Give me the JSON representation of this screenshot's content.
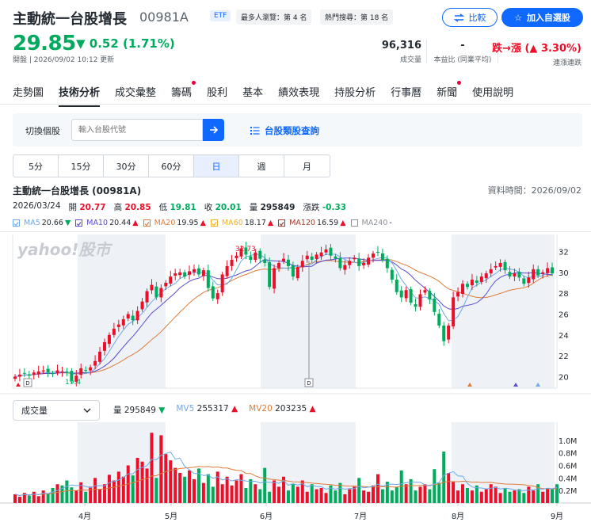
{
  "header": {
    "title": "主動統一台股增長",
    "ticker": "00981A",
    "etf_badge": "ETF",
    "rank1": "最多人瀏覽：第 4 名",
    "rank2": "熱門搜尋：第 18 名",
    "compare_label": "比較",
    "favorite_label": "加入自選股"
  },
  "quote": {
    "price": "29.85",
    "change": "0.52 (1.71%)",
    "update_time": "開盤 | 2026/09/02 10:12 更新",
    "volume": "96,316",
    "volume_label": "成交量",
    "pe": "-",
    "pe_label": "本益比 (同業平均)",
    "streak": "跌→漲 (▲ 3.30%)",
    "streak_label": "連漲連跌"
  },
  "tabs": [
    {
      "label": "走勢圖",
      "dot": false
    },
    {
      "label": "技術分析",
      "dot": false,
      "active": true
    },
    {
      "label": "成交彙整",
      "dot": false
    },
    {
      "label": "籌碼",
      "dot": true
    },
    {
      "label": "股利",
      "dot": false
    },
    {
      "label": "基本",
      "dot": false
    },
    {
      "label": "績效表現",
      "dot": false
    },
    {
      "label": "持股分析",
      "dot": false
    },
    {
      "label": "行事曆",
      "dot": false
    },
    {
      "label": "新聞",
      "dot": true
    },
    {
      "label": "使用說明",
      "dot": false
    }
  ],
  "search": {
    "label": "切換個股",
    "placeholder": "輸入台股代號",
    "category_link": "台股類股查詢"
  },
  "periods": [
    "5分",
    "15分",
    "30分",
    "60分",
    "日",
    "週",
    "月"
  ],
  "selected_period": "日",
  "info": {
    "name": "主動統一台股增長 (00981A)",
    "data_time": "資料時間：2026/09/02",
    "date": "2026/03/24",
    "open_label": "開",
    "open": "20.77",
    "high_label": "高",
    "high": "20.85",
    "low_label": "低",
    "low": "19.81",
    "close_label": "收",
    "close": "20.01",
    "vol_label": "量",
    "vol": "295849",
    "chg_label": "漲跌",
    "chg": "-0.33"
  },
  "ma": [
    {
      "name": "MA5",
      "value": "20.66",
      "arrow": "▼",
      "color": "#6ea8e8"
    },
    {
      "name": "MA10",
      "value": "20.44",
      "arrow": "▲",
      "color": "#5a4bd1"
    },
    {
      "name": "MA20",
      "value": "19.95",
      "arrow": "▲",
      "color": "#e07b39"
    },
    {
      "name": "MA60",
      "value": "18.17",
      "arrow": "▲",
      "color": "#f0b429"
    },
    {
      "name": "MA120",
      "value": "16.59",
      "arrow": "▲",
      "color": "#a23b2a"
    },
    {
      "name": "MA240",
      "value": "-",
      "arrow": "",
      "color": "#8a9099"
    }
  ],
  "volume_panel": {
    "select": "成交量",
    "vol_label": "量",
    "vol": "295849",
    "vol_arrow": "▼",
    "mv5_label": "MV5",
    "mv5": "255317",
    "mv5_arrow": "▲",
    "mv20_label": "MV20",
    "mv20": "203235",
    "mv20_arrow": "▲"
  },
  "chart_data": {
    "type": "candlestick",
    "price_axis_ticks": [
      "32",
      "30",
      "28",
      "26",
      "24",
      "22",
      "20"
    ],
    "ylim": [
      18.9,
      33.4
    ],
    "volume_axis_ticks": [
      "1.0M",
      "0.8M",
      "0.6M",
      "0.4M",
      "0.2M"
    ],
    "month_labels": [
      "4月",
      "5月",
      "6月",
      "7月",
      "8月",
      "9月"
    ],
    "annotations": {
      "high": "32.73",
      "low": "19.4"
    },
    "watermark": "yahoo!股市",
    "closes": [
      20.0,
      20.2,
      20.3,
      20.1,
      20.4,
      20.5,
      20.6,
      20.4,
      20.3,
      20.6,
      20.5,
      20.4,
      19.6,
      20.1,
      20.8,
      20.6,
      20.9,
      21.5,
      22.4,
      23.3,
      24.0,
      24.6,
      25.0,
      25.5,
      26.0,
      25.4,
      26.3,
      27.2,
      28.2,
      28.8,
      27.6,
      28.5,
      29.0,
      29.6,
      29.9,
      30.0,
      29.6,
      30.1,
      30.3,
      29.8,
      30.2,
      28.5,
      27.5,
      28.0,
      29.8,
      30.6,
      31.2,
      31.6,
      32.3,
      31.7,
      31.2,
      31.9,
      31.3,
      30.9,
      28.6,
      30.4,
      30.9,
      31.3,
      30.6,
      29.6,
      30.5,
      31.1,
      31.6,
      31.2,
      31.7,
      31.9,
      32.2,
      31.6,
      31.3,
      30.4,
      30.7,
      31.1,
      31.4,
      30.6,
      30.9,
      31.4,
      31.8,
      31.9,
      31.2,
      30.4,
      29.3,
      28.1,
      27.6,
      28.3,
      27.1,
      26.7,
      27.9,
      28.3,
      27.4,
      26.2,
      24.9,
      23.4,
      24.9,
      27.6,
      28.1,
      28.9,
      28.6,
      29.3,
      29.0,
      29.6,
      29.9,
      30.3,
      30.6,
      30.9,
      30.2,
      29.6,
      29.9,
      29.5,
      28.9,
      29.5,
      30.3,
      29.7,
      30.0,
      30.4,
      29.9
    ],
    "volumes": [
      0.14,
      0.1,
      0.16,
      0.12,
      0.18,
      0.11,
      0.2,
      0.15,
      0.24,
      0.3,
      0.28,
      0.36,
      0.25,
      0.2,
      0.33,
      0.18,
      0.26,
      0.4,
      0.22,
      0.3,
      0.45,
      0.36,
      0.5,
      0.42,
      0.6,
      0.44,
      0.72,
      0.66,
      0.55,
      1.12,
      0.4,
      1.08,
      0.78,
      0.68,
      0.56,
      0.48,
      0.42,
      0.52,
      0.38,
      0.55,
      0.32,
      0.46,
      0.26,
      0.5,
      0.3,
      0.42,
      0.28,
      0.36,
      0.46,
      0.24,
      0.38,
      0.3,
      0.22,
      0.56,
      0.18,
      0.36,
      0.26,
      0.42,
      0.2,
      0.3,
      0.26,
      0.36,
      0.18,
      0.3,
      0.22,
      0.24,
      0.16,
      0.28,
      0.2,
      0.32,
      0.14,
      0.22,
      0.26,
      0.4,
      0.2,
      0.18,
      0.28,
      0.46,
      0.22,
      0.34,
      0.2,
      0.26,
      0.52,
      0.3,
      0.38,
      0.2,
      0.26,
      0.3,
      0.22,
      0.54,
      0.32,
      0.82,
      0.48,
      0.34,
      0.2,
      0.3,
      0.24,
      0.2,
      0.28,
      0.18,
      0.22,
      0.3,
      0.26,
      0.16,
      0.24,
      0.18,
      0.2,
      0.22,
      0.16,
      0.26,
      0.2,
      0.3,
      0.18,
      0.24,
      0.22,
      0.3
    ]
  },
  "colors": {
    "up": "#eb0f29",
    "down": "#00ab5e",
    "accent": "#0f69ff"
  }
}
